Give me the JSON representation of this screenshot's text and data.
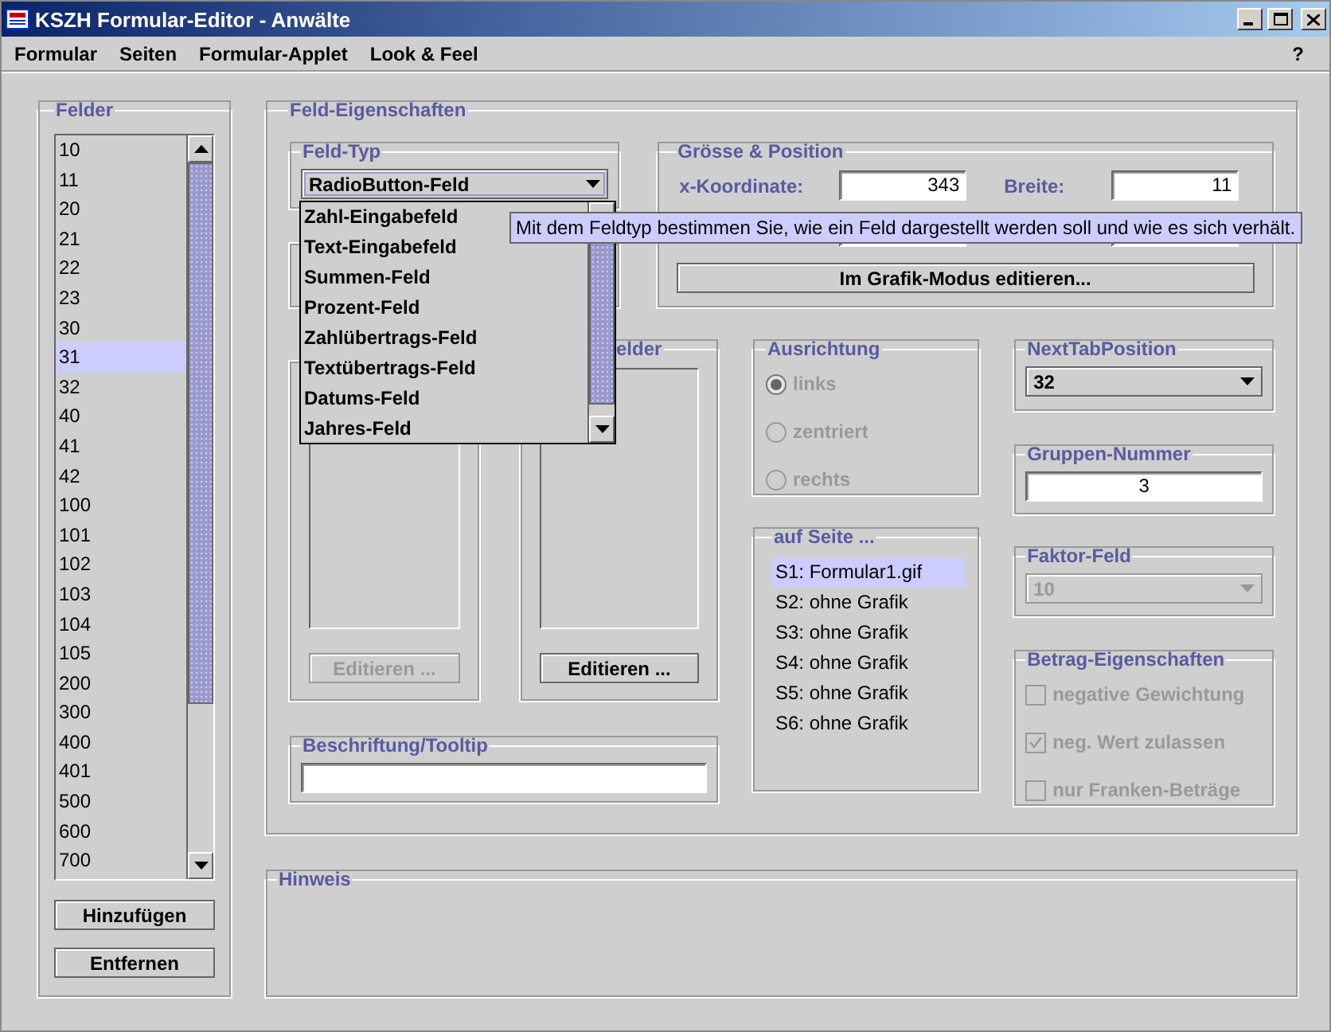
{
  "window": {
    "title": "KSZH Formular-Editor - Anwälte"
  },
  "menu": {
    "items": [
      {
        "label": "Formular"
      },
      {
        "label": "Seiten"
      },
      {
        "label": "Formular-Applet"
      },
      {
        "label": "Look & Feel"
      }
    ],
    "help": "?"
  },
  "felder": {
    "title": "Felder",
    "items": [
      {
        "label": "10",
        "selected": false
      },
      {
        "label": "11",
        "selected": false
      },
      {
        "label": "20",
        "selected": false
      },
      {
        "label": "21",
        "selected": false
      },
      {
        "label": "22",
        "selected": false
      },
      {
        "label": "23",
        "selected": false
      },
      {
        "label": "30",
        "selected": false
      },
      {
        "label": "31",
        "selected": true
      },
      {
        "label": "32",
        "selected": false
      },
      {
        "label": "40",
        "selected": false
      },
      {
        "label": "41",
        "selected": false
      },
      {
        "label": "42",
        "selected": false
      },
      {
        "label": "100",
        "selected": false
      },
      {
        "label": "101",
        "selected": false
      },
      {
        "label": "102",
        "selected": false
      },
      {
        "label": "103",
        "selected": false
      },
      {
        "label": "104",
        "selected": false
      },
      {
        "label": "105",
        "selected": false
      },
      {
        "label": "200",
        "selected": false
      },
      {
        "label": "300",
        "selected": false
      },
      {
        "label": "400",
        "selected": false
      },
      {
        "label": "401",
        "selected": false
      },
      {
        "label": "500",
        "selected": false
      },
      {
        "label": "600",
        "selected": false
      },
      {
        "label": "700",
        "selected": false
      }
    ],
    "buttons": [
      "Hinzufügen",
      "Entfernen"
    ]
  },
  "properties": {
    "title": "Feld-Eigenschaften",
    "feld_typ": {
      "title": "Feld-Typ",
      "value": "RadioButton-Feld",
      "expanded": true,
      "options": [
        "Zahl-Eingabefeld",
        "Text-Eingabefeld",
        "Summen-Feld",
        "Prozent-Feld",
        "Zahlübertrags-Feld",
        "Textübertrags-Feld",
        "Datums-Feld",
        "Jahres-Feld"
      ],
      "tooltip": "Mit dem Feldtyp bestimmen Sie, wie ein Feld dargestellt werden soll und wie es sich verhält."
    },
    "groesse_position": {
      "title": "Grösse & Position",
      "fields": [
        {
          "label": "x-Koordinate:",
          "value": "343"
        },
        {
          "label": "Breite:",
          "value": "11"
        }
      ],
      "button": "Im Grafik-Modus editieren..."
    },
    "list_panels": [
      {
        "button": {
          "label": "Editieren ...",
          "disabled": true
        }
      },
      {
        "title": "elder",
        "button": {
          "label": "Editieren ...",
          "disabled": false
        }
      }
    ],
    "beschriftung": {
      "title": "Beschriftung/Tooltip"
    },
    "ausrichtung": {
      "title": "Ausrichtung",
      "disabled": true,
      "options": [
        {
          "label": "links",
          "selected": true
        },
        {
          "label": "zentriert",
          "selected": false
        },
        {
          "label": "rechts",
          "selected": false
        }
      ]
    },
    "auf_seite": {
      "title": "auf Seite ...",
      "items": [
        {
          "label": "S1: Formular1.gif",
          "selected": true
        },
        {
          "label": "S2: ohne Grafik",
          "selected": false
        },
        {
          "label": "S3: ohne Grafik",
          "selected": false
        },
        {
          "label": "S4: ohne Grafik",
          "selected": false
        },
        {
          "label": "S5: ohne Grafik",
          "selected": false
        },
        {
          "label": "S6: ohne Grafik",
          "selected": false
        }
      ]
    },
    "next_tab": {
      "title": "NextTabPosition",
      "value": "32",
      "disabled": false
    },
    "gruppen": {
      "title": "Gruppen-Nummer",
      "value": "3"
    },
    "faktor": {
      "title": "Faktor-Feld",
      "value": "10",
      "disabled": true
    },
    "betrag": {
      "title": "Betrag-Eigenschaften",
      "disabled": true,
      "options": [
        {
          "label": "negative Gewichtung",
          "checked": false
        },
        {
          "label": "neg. Wert zulassen",
          "checked": true
        },
        {
          "label": "nur Franken-Beträge",
          "checked": false
        }
      ]
    }
  },
  "hinweis": {
    "title": "Hinweis"
  }
}
